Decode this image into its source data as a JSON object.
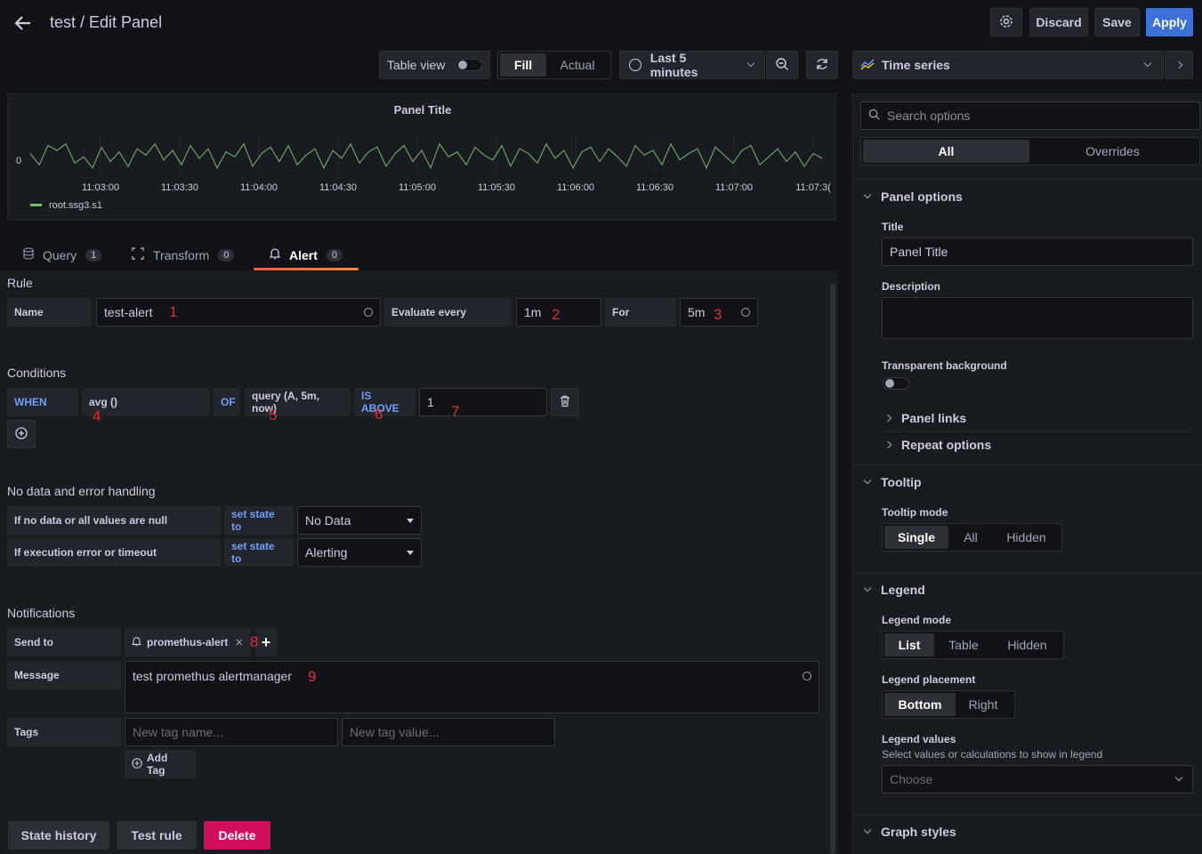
{
  "header": {
    "title": "test / Edit Panel",
    "discard_label": "Discard",
    "save_label": "Save",
    "apply_label": "Apply"
  },
  "toolbar": {
    "table_view_label": "Table view",
    "fill_label": "Fill",
    "actual_label": "Actual",
    "time_range": "Last 5 minutes",
    "visualization": "Time series"
  },
  "chart_data": {
    "type": "line",
    "title": "Panel Title",
    "x_tick_labels": [
      "11:03:00",
      "11:03:30",
      "11:04:00",
      "11:04:30",
      "11:05:00",
      "11:05:30",
      "11:06:00",
      "11:06:30",
      "11:07:00",
      "11:07:3("
    ],
    "y_tick_labels": [
      "0"
    ],
    "series": [
      {
        "name": "root.ssg3.s1",
        "color": "#73bf69",
        "values": [
          0.3,
          -0.4,
          0.8,
          0.5,
          0.9,
          -0.3,
          0.1,
          -0.6,
          0.7,
          -0.2,
          0.4,
          -0.5,
          0.6,
          0.2,
          0.9,
          -0.1,
          0.5,
          -0.4,
          0.8,
          0.0,
          0.6,
          -0.6,
          0.4,
          0.1,
          0.9,
          -0.5,
          0.3,
          0.7,
          -0.2,
          0.8,
          -0.4,
          0.2,
          0.6,
          -0.6,
          0.5,
          0.0,
          0.9,
          -0.3,
          0.4,
          0.7,
          -0.5,
          0.3,
          0.8,
          -0.2,
          0.5,
          -0.6,
          0.9,
          0.1,
          0.4,
          -0.4,
          0.7,
          0.2,
          -0.1,
          0.8,
          -0.5,
          0.6,
          0.3,
          -0.3,
          0.9,
          0.0,
          0.5,
          -0.6,
          0.4,
          0.7,
          -0.2,
          0.6,
          0.1,
          -0.5,
          0.8,
          0.2,
          0.5,
          -0.4,
          0.9,
          -0.1,
          0.3,
          0.6,
          -0.6,
          0.7,
          0.2,
          -0.3,
          0.5,
          0.8,
          -0.4,
          0.1,
          0.6,
          -0.2,
          0.4,
          -0.5,
          0.3,
          0.0
        ]
      }
    ]
  },
  "tabs": [
    {
      "label": "Query",
      "count": "1"
    },
    {
      "label": "Transform",
      "count": "0"
    },
    {
      "label": "Alert",
      "count": "0"
    }
  ],
  "rule": {
    "section": "Rule",
    "name_label": "Name",
    "name_value": "test-alert",
    "evaluate_label": "Evaluate every",
    "evaluate_value": "1m",
    "for_label": "For",
    "for_value": "5m"
  },
  "conditions": {
    "section": "Conditions",
    "when": "WHEN",
    "func": "avg ()",
    "of": "OF",
    "query": "query (A, 5m, now)",
    "evaluator": "IS ABOVE",
    "threshold": "1"
  },
  "nodata": {
    "section": "No data and error handling",
    "row1_label": "If no data or all values are null",
    "row1_set": "set state to",
    "row1_value": "No Data",
    "row2_label": "If execution error or timeout",
    "row2_set": "set state to",
    "row2_value": "Alerting"
  },
  "notifications": {
    "section": "Notifications",
    "send_to_label": "Send to",
    "channel": "promethus-alert",
    "message_label": "Message",
    "message_value": "test promethus alertmanager",
    "tags_label": "Tags",
    "tag_name_placeholder": "New tag name...",
    "tag_value_placeholder": "New tag value...",
    "add_tag_label": "Add Tag"
  },
  "footer": {
    "state_history": "State history",
    "test_rule": "Test rule",
    "delete": "Delete"
  },
  "annotations": [
    "1",
    "2",
    "3",
    "4",
    "5",
    "6",
    "7",
    "8",
    "9"
  ],
  "options": {
    "search_placeholder": "Search options",
    "tab_all": "All",
    "tab_overrides": "Overrides",
    "panel_options": "Panel options",
    "title_label": "Title",
    "title_value": "Panel Title",
    "description_label": "Description",
    "transparent_label": "Transparent background",
    "panel_links": "Panel links",
    "repeat_options": "Repeat options",
    "tooltip": "Tooltip",
    "tooltip_mode_label": "Tooltip mode",
    "tooltip_modes": [
      "Single",
      "All",
      "Hidden"
    ],
    "legend": "Legend",
    "legend_mode_label": "Legend mode",
    "legend_modes": [
      "List",
      "Table",
      "Hidden"
    ],
    "legend_placement_label": "Legend placement",
    "legend_placements": [
      "Bottom",
      "Right"
    ],
    "legend_values_label": "Legend values",
    "legend_values_desc": "Select values or calculations to show in legend",
    "legend_values_placeholder": "Choose",
    "graph_styles": "Graph styles"
  }
}
